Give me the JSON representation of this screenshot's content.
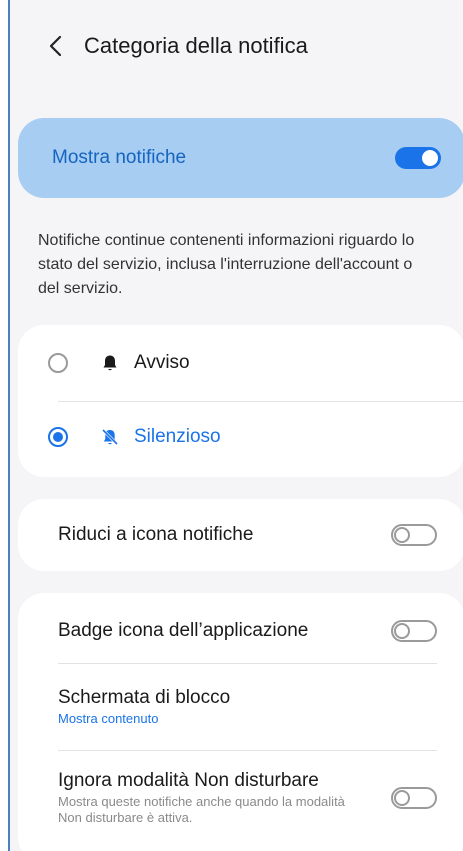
{
  "header": {
    "title": "Categoria della notifica",
    "back_icon": "chevron-left-icon"
  },
  "master": {
    "label": "Mostra notifiche",
    "enabled": true
  },
  "description": "Notifiche continue contenenti informazioni riguardo lo stato del servizio, inclusa l'interruzione dell'account o del servizio.",
  "alert_modes": [
    {
      "label": "Avviso",
      "icon": "bell-icon",
      "selected": false
    },
    {
      "label": "Silenzioso",
      "icon": "bell-off-icon",
      "selected": true
    }
  ],
  "minimize": {
    "label": "Riduci a icona notifiche",
    "enabled": false
  },
  "settings": {
    "badge": {
      "label": "Badge icona dell’applicazione",
      "enabled": false
    },
    "lock_screen": {
      "label": "Schermata di blocco",
      "value": "Mostra contenuto"
    },
    "dnd": {
      "label": "Ignora modalità Non disturbare",
      "sub": "Mostra queste notifiche anche quando la modalità Non disturbare è attiva.",
      "enabled": false
    }
  },
  "colors": {
    "accent": "#1a73e8",
    "master_bg": "#a8cdf3",
    "background": "#f5f5f7"
  }
}
